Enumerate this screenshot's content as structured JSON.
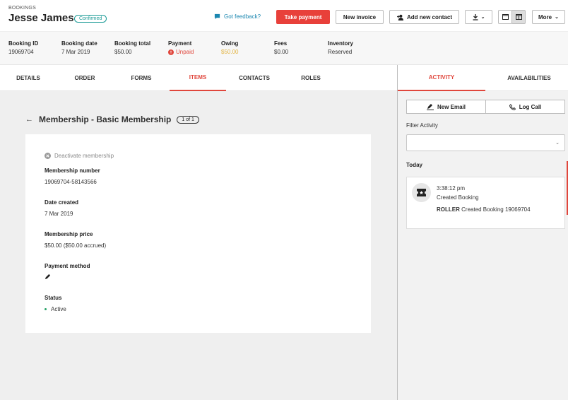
{
  "header": {
    "breadcrumb": "BOOKINGS",
    "customer_name": "Jesse James",
    "status_badge": "Confirmed",
    "feedback_label": "Got feedback?",
    "take_payment_label": "Take payment",
    "new_invoice_label": "New invoice",
    "add_contact_label": "Add new contact",
    "more_label": "More"
  },
  "summary": {
    "booking_id": {
      "label": "Booking ID",
      "value": "19069704"
    },
    "booking_date": {
      "label": "Booking date",
      "value": "7 Mar 2019"
    },
    "booking_total": {
      "label": "Booking total",
      "value": "$50.00"
    },
    "payment": {
      "label": "Payment",
      "value": "Unpaid"
    },
    "owing": {
      "label": "Owing",
      "value": "$50.00"
    },
    "fees": {
      "label": "Fees",
      "value": "$0.00"
    },
    "inventory": {
      "label": "Inventory",
      "value": "Reserved"
    }
  },
  "tabs": [
    "DETAILS",
    "ORDER",
    "FORMS",
    "ITEMS",
    "CONTACTS",
    "ROLES"
  ],
  "active_tab": "ITEMS",
  "item": {
    "title": "Membership - Basic Membership",
    "counter": "1 of 1",
    "deactivate_label": "Deactivate membership",
    "fields": {
      "membership_number": {
        "label": "Membership number",
        "value": "19069704-58143566"
      },
      "date_created": {
        "label": "Date created",
        "value": "7 Mar 2019"
      },
      "membership_price": {
        "label": "Membership price",
        "value": "$50.00 ($50.00 accrued)"
      },
      "payment_method": {
        "label": "Payment method"
      },
      "status": {
        "label": "Status",
        "value": "Active"
      }
    }
  },
  "right_panel": {
    "tabs": [
      "ACTIVITY",
      "AVAILABILITIES"
    ],
    "active_tab": "ACTIVITY",
    "new_email_label": "New Email",
    "log_call_label": "Log Call",
    "filter_label": "Filter Activity",
    "filter_value": "",
    "group_label": "Today",
    "activity": {
      "time": "3:38:12 pm",
      "type": "Created Booking",
      "actor": "ROLLER",
      "message": "Created Booking 19069704"
    }
  },
  "colors": {
    "accent": "#e0463c",
    "confirmed": "#1a9a96",
    "owing": "#e2b340",
    "link": "#1b87b0"
  }
}
